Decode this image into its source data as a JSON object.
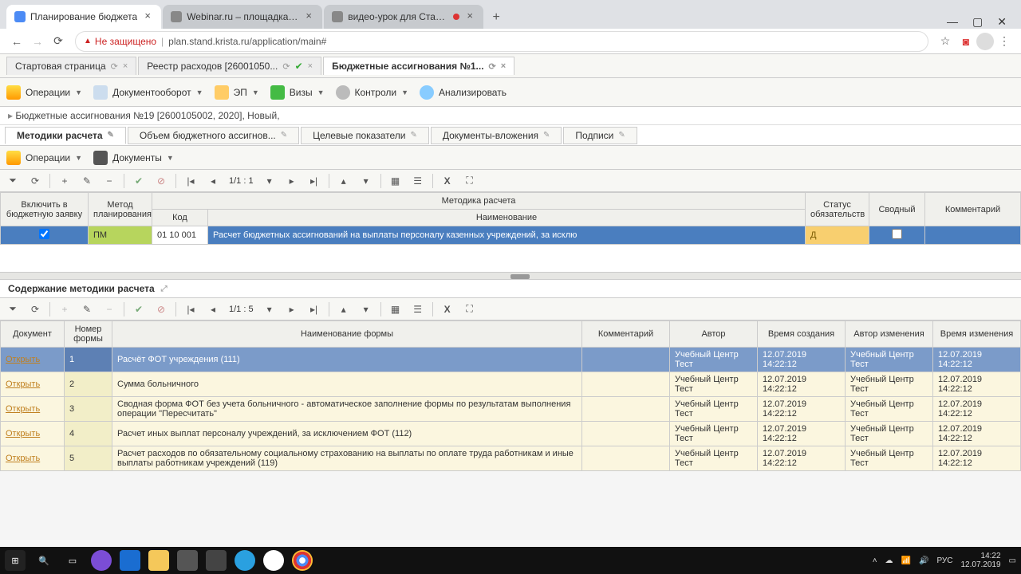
{
  "chrome": {
    "tabs": [
      {
        "label": "Планирование бюджета",
        "fav_color": "#4c8bf5"
      },
      {
        "label": "Webinar.ru – площадка для про",
        "fav_color": "#888"
      },
      {
        "label": "видео-урок для Ставропол",
        "fav_color": "#888",
        "rec": true
      }
    ],
    "warn": "Не защищено",
    "url": "plan.stand.krista.ru/application/main#"
  },
  "app_tabs": [
    {
      "label": "Стартовая страница"
    },
    {
      "label": "Реестр расходов [26001050...",
      "ok": true
    },
    {
      "label": "Бюджетные ассигнования №1...",
      "sel": true
    }
  ],
  "toolbar": {
    "ops": "Операции",
    "doc": "Документооборот",
    "ep": "ЭП",
    "visas": "Визы",
    "ctrl": "Контроли",
    "analyze": "Анализировать"
  },
  "breadcrumb": "Бюджетные ассигнования №19 [2600105002, 2020], Новый,",
  "sub_tabs": [
    "Методики расчета",
    "Объем бюджетного ассигнов...",
    "Целевые показатели",
    "Документы-вложения",
    "Подписи"
  ],
  "ops_bar": {
    "ops": "Операции",
    "docs": "Документы"
  },
  "pager_top": "1/1 : 1",
  "grid_top": {
    "headers": {
      "include": "Включить в бюджетную заявку",
      "method": "Метод планирования",
      "methodika": "Методика расчета",
      "kod": "Код",
      "name": "Наименование",
      "status": "Статус обязательств",
      "svod": "Сводный",
      "comment": "Комментарий"
    },
    "row": {
      "method": "ПМ",
      "kod": "01 10 001",
      "name": "Расчет бюджетных ассигнований на выплаты персоналу казенных учреждений, за исклю",
      "status": "Д"
    }
  },
  "panel2_title": "Содержание методики расчета",
  "pager_bot": "1/1 : 5",
  "grid_bot": {
    "headers": {
      "doc": "Документ",
      "num": "Номер формы",
      "name": "Наименование формы",
      "comment": "Комментарий",
      "author": "Автор",
      "created": "Время создания",
      "modifier": "Автор изменения",
      "modified": "Время изменения"
    },
    "open": "Открыть",
    "rows": [
      {
        "n": "1",
        "name": "Расчёт ФОТ учреждения (111)",
        "author": "Учебный Центр Тест",
        "created": "12.07.2019 14:22:12",
        "modifier": "Учебный Центр Тест",
        "modified": "12.07.2019 14:22:12"
      },
      {
        "n": "2",
        "name": "Сумма больничного",
        "author": "Учебный Центр Тест",
        "created": "12.07.2019 14:22:12",
        "modifier": "Учебный Центр Тест",
        "modified": "12.07.2019 14:22:12"
      },
      {
        "n": "3",
        "name": "Сводная форма ФОТ без учета больничного - автоматическое заполнение формы по результатам выполнения операции \"Пересчитать\"",
        "author": "Учебный Центр Тест",
        "created": "12.07.2019 14:22:12",
        "modifier": "Учебный Центр Тест",
        "modified": "12.07.2019 14:22:12"
      },
      {
        "n": "4",
        "name": "Расчет иных выплат персоналу учреждений, за исключением ФОТ (112)",
        "author": "Учебный Центр Тест",
        "created": "12.07.2019 14:22:12",
        "modifier": "Учебный Центр Тест",
        "modified": "12.07.2019 14:22:12"
      },
      {
        "n": "5",
        "name": "Расчет расходов по обязательному социальному страхованию на выплаты по оплате труда работникам и иные выплаты работникам учреждений (119)",
        "author": "Учебный Центр Тест",
        "created": "12.07.2019 14:22:12",
        "modifier": "Учебный Центр Тест",
        "modified": "12.07.2019 14:22:12"
      }
    ]
  },
  "tray": {
    "lang": "РУС",
    "time": "14:22",
    "date": "12.07.2019"
  }
}
